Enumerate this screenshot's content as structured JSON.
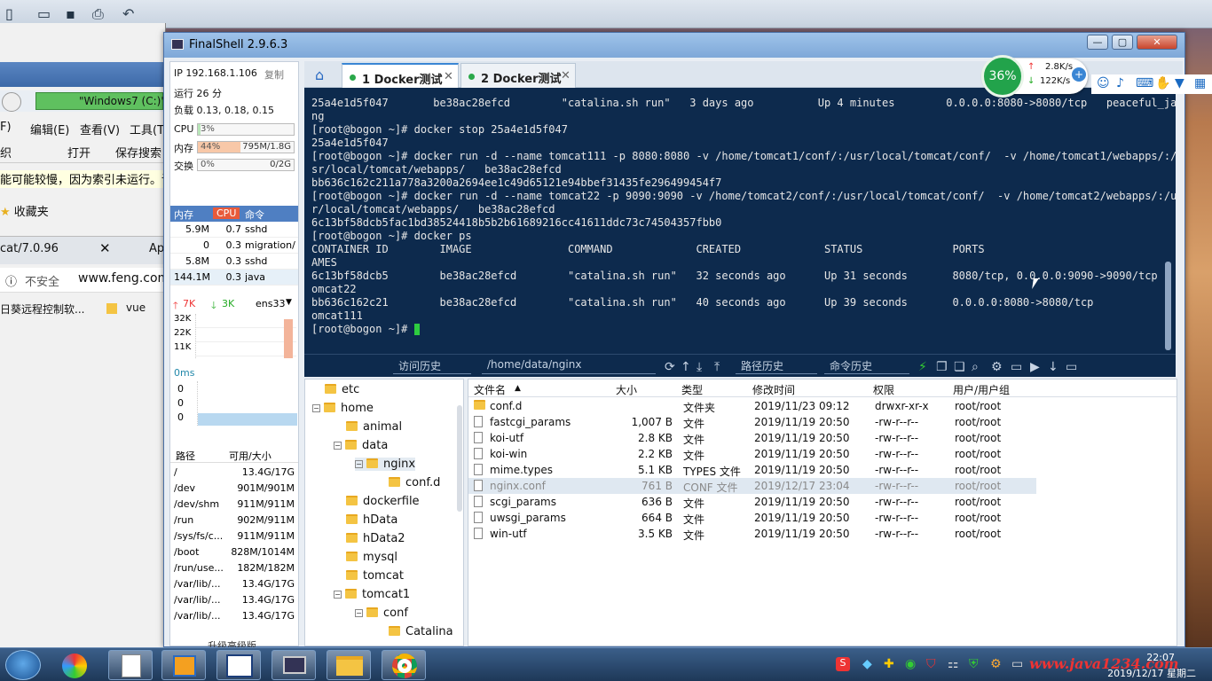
{
  "bg": {
    "address": "\"Windows7 (C:)\"",
    "menu": [
      "F)",
      "编辑(E)",
      "查看(V)",
      "工具(T)"
    ],
    "toolbar": [
      "织",
      "打开",
      "保存搜索"
    ],
    "warning": "能可能较慢，因为索引未运行。请单",
    "favorites": "收藏夹",
    "tab1": "cat/7.0.96",
    "tab2": "Ap",
    "insecure": "不安全",
    "url": "www.feng.com",
    "bm1": "日葵远程控制软...",
    "bm2": "vue"
  },
  "window": {
    "title": "FinalShell 2.9.6.3"
  },
  "sysinfo": {
    "ip": "IP 192.168.1.106",
    "copy": "复制",
    "uptime": "运行 26 分",
    "load": "负载 0.13, 0.18, 0.15",
    "cpu_label": "CPU",
    "cpu_value": "3%",
    "cpu_pct": 3,
    "mem_label": "内存",
    "mem_value": "44%",
    "mem_detail": "795M/1.8G",
    "mem_pct": 44,
    "swap_label": "交换",
    "swap_value": "0%",
    "swap_detail": "0/2G",
    "swap_pct": 0
  },
  "proc": {
    "headers": [
      "内存",
      "CPU",
      "命令"
    ],
    "rows": [
      [
        "5.9M",
        "0.7",
        "sshd"
      ],
      [
        "0",
        "0.3",
        "migration/"
      ],
      [
        "5.8M",
        "0.3",
        "sshd"
      ],
      [
        "144.1M",
        "0.3",
        "java"
      ]
    ]
  },
  "net": {
    "up": "7K",
    "down": "3K",
    "iface": "ens33",
    "y": [
      "32K",
      "22K",
      "11K"
    ]
  },
  "ping": {
    "label": "0ms",
    "y": [
      "0",
      "0",
      "0"
    ]
  },
  "disk": {
    "headers": [
      "路径",
      "可用/大小"
    ],
    "rows": [
      [
        "/",
        "13.4G/17G"
      ],
      [
        "/dev",
        "901M/901M"
      ],
      [
        "/dev/shm",
        "911M/911M"
      ],
      [
        "/run",
        "902M/911M"
      ],
      [
        "/sys/fs/c...",
        "911M/911M"
      ],
      [
        "/boot",
        "828M/1014M"
      ],
      [
        "/run/use...",
        "182M/182M"
      ],
      [
        "/var/lib/...",
        "13.4G/17G"
      ],
      [
        "/var/lib/...",
        "13.4G/17G"
      ],
      [
        "/var/lib/...",
        "13.4G/17G"
      ]
    ],
    "upgrade": "升级高级版"
  },
  "tabs": [
    {
      "label": "1 Docker测试"
    },
    {
      "label": "2 Docker测试"
    }
  ],
  "terminal": {
    "lines": [
      "25a4e1d5f047       be38ac28efcd        \"catalina.sh run\"   3 days ago          Up 4 minutes        0.0.0.0:8080->8080/tcp   peaceful_ja",
      "ng",
      "[root@bogon ~]# docker stop 25a4e1d5f047",
      "25a4e1d5f047",
      "[root@bogon ~]# docker run -d --name tomcat111 -p 8080:8080 -v /home/tomcat1/conf/:/usr/local/tomcat/conf/  -v /home/tomcat1/webapps/:/u",
      "sr/local/tomcat/webapps/   be38ac28efcd",
      "bb636c162c211a778a3200a2694ee1c49d65121e94bbef31435fe296499454f7",
      "[root@bogon ~]# docker run -d --name tomcat22 -p 9090:9090 -v /home/tomcat2/conf/:/usr/local/tomcat/conf/  -v /home/tomcat2/webapps/:/us",
      "r/local/tomcat/webapps/   be38ac28efcd",
      "6c13bf58dcb5fac1bd38524418b5b2b61689216cc41611ddc73c74504357fbb0",
      "[root@bogon ~]# docker ps",
      "CONTAINER ID        IMAGE               COMMAND             CREATED             STATUS              PORTS                              N",
      "AMES",
      "6c13bf58dcb5        be38ac28efcd        \"catalina.sh run\"   32 seconds ago      Up 31 seconds       8080/tcp, 0.0.0.0:9090->9090/tcp   t",
      "omcat22",
      "bb636c162c21        be38ac28efcd        \"catalina.sh run\"   40 seconds ago      Up 39 seconds       0.0.0.0:8080->8080/tcp             t",
      "omcat111"
    ],
    "prompt": "[root@bogon ~]# "
  },
  "termbar": {
    "history": "访问历史",
    "path": "/home/data/nginx",
    "path_history": "路径历史",
    "cmd_history": "命令历史"
  },
  "tree": {
    "items": [
      {
        "label": "etc"
      },
      {
        "label": "home"
      },
      {
        "label": "animal"
      },
      {
        "label": "data"
      },
      {
        "label": "nginx"
      },
      {
        "label": "conf.d"
      },
      {
        "label": "dockerfile"
      },
      {
        "label": "hData"
      },
      {
        "label": "hData2"
      },
      {
        "label": "mysql"
      },
      {
        "label": "tomcat"
      },
      {
        "label": "tomcat1"
      },
      {
        "label": "conf"
      },
      {
        "label": "Catalina"
      }
    ]
  },
  "files": {
    "headers": [
      "文件名",
      "大小",
      "类型",
      "修改时间",
      "权限",
      "用户/用户组"
    ],
    "rows": [
      [
        "conf.d",
        "",
        "文件夹",
        "2019/11/23 09:12",
        "drwxr-xr-x",
        "root/root"
      ],
      [
        "fastcgi_params",
        "1,007 B",
        "文件",
        "2019/11/19 20:50",
        "-rw-r--r--",
        "root/root"
      ],
      [
        "koi-utf",
        "2.8 KB",
        "文件",
        "2019/11/19 20:50",
        "-rw-r--r--",
        "root/root"
      ],
      [
        "koi-win",
        "2.2 KB",
        "文件",
        "2019/11/19 20:50",
        "-rw-r--r--",
        "root/root"
      ],
      [
        "mime.types",
        "5.1 KB",
        "TYPES 文件",
        "2019/11/19 20:50",
        "-rw-r--r--",
        "root/root"
      ],
      [
        "nginx.conf",
        "761 B",
        "CONF 文件",
        "2019/12/17 23:04",
        "-rw-r--r--",
        "root/root"
      ],
      [
        "scgi_params",
        "636 B",
        "文件",
        "2019/11/19 20:50",
        "-rw-r--r--",
        "root/root"
      ],
      [
        "uwsgi_params",
        "664 B",
        "文件",
        "2019/11/19 20:50",
        "-rw-r--r--",
        "root/root"
      ],
      [
        "win-utf",
        "3.5 KB",
        "文件",
        "2019/11/19 20:50",
        "-rw-r--r--",
        "root/root"
      ]
    ]
  },
  "speed": {
    "percent": "36%",
    "up": "2.8K/s",
    "down": "122K/s"
  },
  "taskbar": {
    "watermark": "www.java1234.com",
    "time": "22:07",
    "date": "2019/12/17 星期二"
  }
}
